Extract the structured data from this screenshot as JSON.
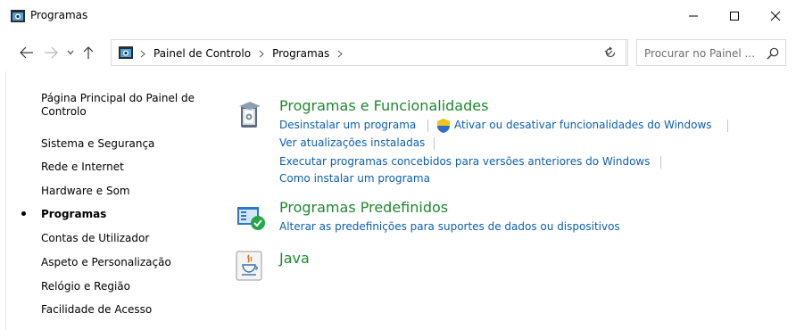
{
  "window": {
    "title": "Programas"
  },
  "address": {
    "crumbs": [
      "Painel de Controlo",
      "Programas"
    ]
  },
  "search": {
    "placeholder": "Procurar no Painel ..."
  },
  "sidebar": {
    "home": "Página Principal do Painel de Controlo",
    "items": [
      {
        "label": "Sistema e Segurança"
      },
      {
        "label": "Rede e Internet"
      },
      {
        "label": "Hardware e Som"
      },
      {
        "label": "Programas",
        "active": true
      },
      {
        "label": "Contas de Utilizador"
      },
      {
        "label": "Aspeto e Personalização"
      },
      {
        "label": "Relógio e Região"
      },
      {
        "label": "Facilidade de Acesso"
      }
    ]
  },
  "sections": [
    {
      "title": "Programas e Funcionalidades",
      "icon": "programs-features-icon",
      "links": [
        "Desinstalar um programa",
        "Ativar ou desativar funcionalidades do Windows",
        "Ver atualizações instaladas",
        "Executar programas concebidos para versões anteriores do Windows",
        "Como instalar um programa"
      ]
    },
    {
      "title": "Programas Predefinidos",
      "icon": "default-programs-icon",
      "links": [
        "Alterar as predefinições para suportes de dados ou dispositivos"
      ]
    },
    {
      "title": "Java",
      "icon": "java-icon",
      "links": []
    }
  ],
  "colors": {
    "section_title": "#1e8a2e",
    "link": "#0d5fae"
  }
}
